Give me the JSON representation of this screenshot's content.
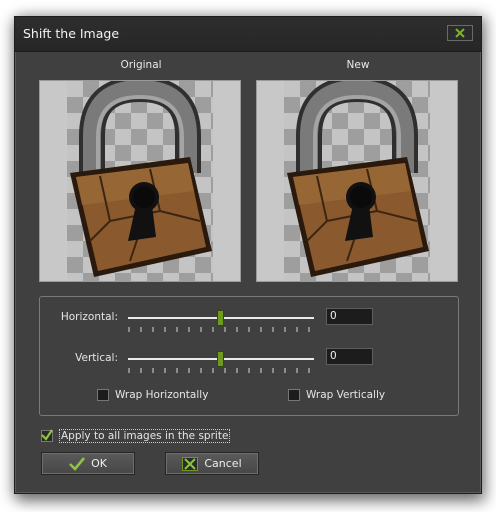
{
  "window": {
    "title": "Shift the Image"
  },
  "preview": {
    "original_label": "Original",
    "new_label": "New"
  },
  "horizontal": {
    "label": "Horizontal:",
    "value": "0"
  },
  "vertical": {
    "label": "Vertical:",
    "value": "0"
  },
  "options": {
    "wrap_horizontally": {
      "label": "Wrap Horizontally",
      "checked": false
    },
    "wrap_vertically": {
      "label": "Wrap Vertically",
      "checked": false
    },
    "apply_all": {
      "label": "Apply to all images in the sprite",
      "checked": true
    }
  },
  "buttons": {
    "ok": "OK",
    "cancel": "Cancel"
  },
  "icons": {
    "close": "close-icon",
    "ok": "checkmark-icon",
    "cancel": "cancel-x-icon",
    "lock": "padlock-image"
  },
  "colors": {
    "accent_green": "#6f9a1d",
    "dialog_bg": "#404040",
    "field_bg": "#1c1c1c"
  }
}
